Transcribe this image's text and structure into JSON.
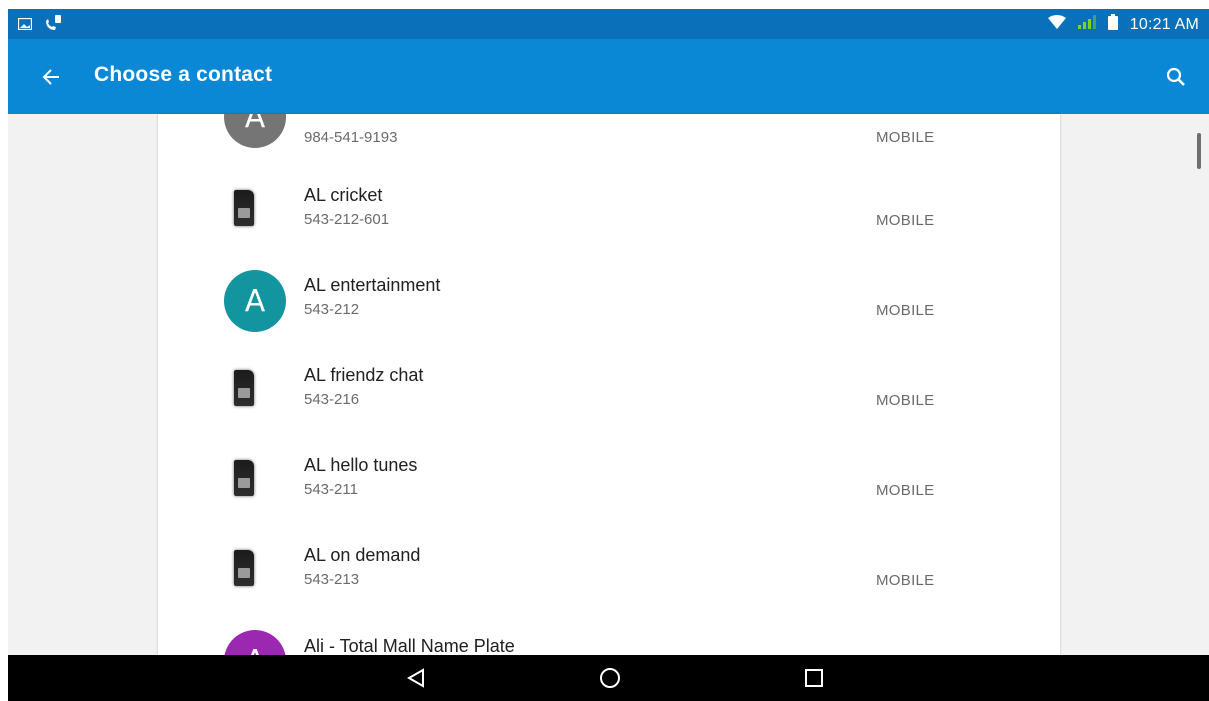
{
  "status_bar": {
    "left_icons": [
      "gallery-notification-icon",
      "call-notification-icon"
    ],
    "right_icons": [
      "wifi-icon",
      "signal-icon",
      "battery-icon"
    ],
    "time": "10:21 AM"
  },
  "app_bar": {
    "title": "Choose a contact",
    "back_icon": "arrow-back-icon",
    "search_icon": "search-icon",
    "color": "#0a88d6",
    "status_color": "#0a70b9"
  },
  "contacts": [
    {
      "avatar_type": "letter",
      "avatar_letter": "A",
      "avatar_color": "#757575",
      "name": "",
      "phone": "984-541-9193",
      "type": "MOBILE"
    },
    {
      "avatar_type": "sim",
      "name": "AL cricket",
      "phone": "543-212-601",
      "type": "MOBILE"
    },
    {
      "avatar_type": "letter",
      "avatar_letter": "A",
      "avatar_color": "#12959e",
      "name": "AL entertainment",
      "phone": "543-212",
      "type": "MOBILE"
    },
    {
      "avatar_type": "sim",
      "name": "AL friendz chat",
      "phone": "543-216",
      "type": "MOBILE"
    },
    {
      "avatar_type": "sim",
      "name": "AL hello tunes",
      "phone": "543-211",
      "type": "MOBILE"
    },
    {
      "avatar_type": "sim",
      "name": "AL on demand",
      "phone": "543-213",
      "type": "MOBILE"
    },
    {
      "avatar_type": "letter",
      "avatar_letter": "A",
      "avatar_color": "#9c27b0",
      "name": "Ali - Total Mall Name Plate",
      "phone": "",
      "type": ""
    }
  ],
  "nav_bar": {
    "back_icon": "nav-back-icon",
    "home_icon": "nav-home-icon",
    "recents_icon": "nav-recents-icon"
  }
}
